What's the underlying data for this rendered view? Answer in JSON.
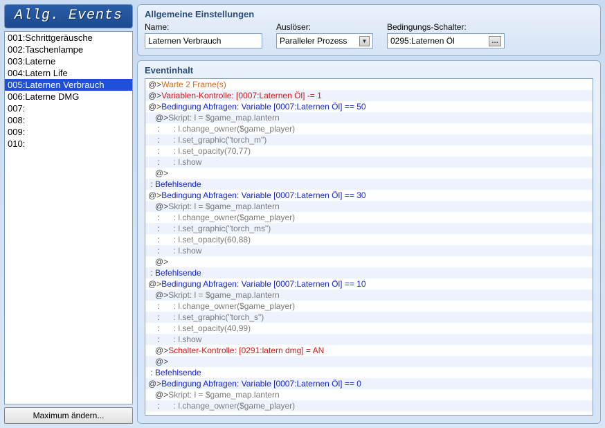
{
  "panel_title": "Allg. Events",
  "events": [
    {
      "label": "001:Schrittgeräusche",
      "selected": false
    },
    {
      "label": "002:Taschenlampe",
      "selected": false
    },
    {
      "label": "003:Laterne",
      "selected": false
    },
    {
      "label": "004:Latern Life",
      "selected": false
    },
    {
      "label": "005:Laternen Verbrauch",
      "selected": true
    },
    {
      "label": "006:Laterne DMG",
      "selected": false
    },
    {
      "label": "007:",
      "selected": false
    },
    {
      "label": "008:",
      "selected": false
    },
    {
      "label": "009:",
      "selected": false
    },
    {
      "label": "010:",
      "selected": false
    }
  ],
  "max_button": "Maximum ändern...",
  "settings": {
    "group_title": "Allgemeine Einstellungen",
    "name_label": "Name:",
    "name_value": "Laternen Verbrauch",
    "trigger_label": "Auslöser:",
    "trigger_value": "Paralleler Prozess",
    "switch_label": "Bedingungs-Schalter:",
    "switch_value": "0295:Laternen Öl"
  },
  "content": {
    "title": "Eventinhalt",
    "lines": [
      {
        "indent": 0,
        "prefix": "@>",
        "text": "Warte 2 Frame(s)",
        "color": "c-orange"
      },
      {
        "indent": 0,
        "prefix": "@>",
        "text": "Variablen-Kontrolle: [0007:Laternen Öl] -= 1",
        "color": "c-red"
      },
      {
        "indent": 0,
        "prefix": "@>",
        "text": "Bedingung Abfragen: Variable [0007:Laternen Öl] == 50",
        "color": "c-blue"
      },
      {
        "indent": 1,
        "prefix": "@>",
        "text": "Skript: l = $game_map.lantern",
        "color": "c-gray"
      },
      {
        "indent": 1,
        "prefix": " :",
        "text": "      : l.change_owner($game_player)",
        "color": "c-gray"
      },
      {
        "indent": 1,
        "prefix": " :",
        "text": "      : l.set_graphic(\"torch_m\")",
        "color": "c-gray"
      },
      {
        "indent": 1,
        "prefix": " :",
        "text": "      : l.set_opacity(70,77)",
        "color": "c-gray"
      },
      {
        "indent": 1,
        "prefix": " :",
        "text": "      : l.show",
        "color": "c-gray"
      },
      {
        "indent": 1,
        "prefix": "@>",
        "text": "",
        "color": "c-black"
      },
      {
        "indent": 0,
        "prefix": " :",
        "text": " Befehlsende",
        "color": "c-blue"
      },
      {
        "indent": 0,
        "prefix": "@>",
        "text": "Bedingung Abfragen: Variable [0007:Laternen Öl] == 30",
        "color": "c-blue"
      },
      {
        "indent": 1,
        "prefix": "@>",
        "text": "Skript: l = $game_map.lantern",
        "color": "c-gray"
      },
      {
        "indent": 1,
        "prefix": " :",
        "text": "      : l.change_owner($game_player)",
        "color": "c-gray"
      },
      {
        "indent": 1,
        "prefix": " :",
        "text": "      : l.set_graphic(\"torch_ms\")",
        "color": "c-gray"
      },
      {
        "indent": 1,
        "prefix": " :",
        "text": "      : l.set_opacity(60,88)",
        "color": "c-gray"
      },
      {
        "indent": 1,
        "prefix": " :",
        "text": "      : l.show",
        "color": "c-gray"
      },
      {
        "indent": 1,
        "prefix": "@>",
        "text": "",
        "color": "c-black"
      },
      {
        "indent": 0,
        "prefix": " :",
        "text": " Befehlsende",
        "color": "c-blue"
      },
      {
        "indent": 0,
        "prefix": "@>",
        "text": "Bedingung Abfragen: Variable [0007:Laternen Öl] == 10",
        "color": "c-blue"
      },
      {
        "indent": 1,
        "prefix": "@>",
        "text": "Skript: l = $game_map.lantern",
        "color": "c-gray"
      },
      {
        "indent": 1,
        "prefix": " :",
        "text": "      : l.change_owner($game_player)",
        "color": "c-gray"
      },
      {
        "indent": 1,
        "prefix": " :",
        "text": "      : l.set_graphic(\"torch_s\")",
        "color": "c-gray"
      },
      {
        "indent": 1,
        "prefix": " :",
        "text": "      : l.set_opacity(40,99)",
        "color": "c-gray"
      },
      {
        "indent": 1,
        "prefix": " :",
        "text": "      : l.show",
        "color": "c-gray"
      },
      {
        "indent": 1,
        "prefix": "@>",
        "text": "Schalter-Kontrolle: [0291:latern dmg] = AN",
        "color": "c-red"
      },
      {
        "indent": 1,
        "prefix": "@>",
        "text": "",
        "color": "c-black"
      },
      {
        "indent": 0,
        "prefix": " :",
        "text": " Befehlsende",
        "color": "c-blue"
      },
      {
        "indent": 0,
        "prefix": "@>",
        "text": "Bedingung Abfragen: Variable [0007:Laternen Öl] == 0",
        "color": "c-blue"
      },
      {
        "indent": 1,
        "prefix": "@>",
        "text": "Skript: l = $game_map.lantern",
        "color": "c-gray"
      },
      {
        "indent": 1,
        "prefix": " :",
        "text": "      : l.change_owner($game_player)",
        "color": "c-gray"
      }
    ]
  }
}
